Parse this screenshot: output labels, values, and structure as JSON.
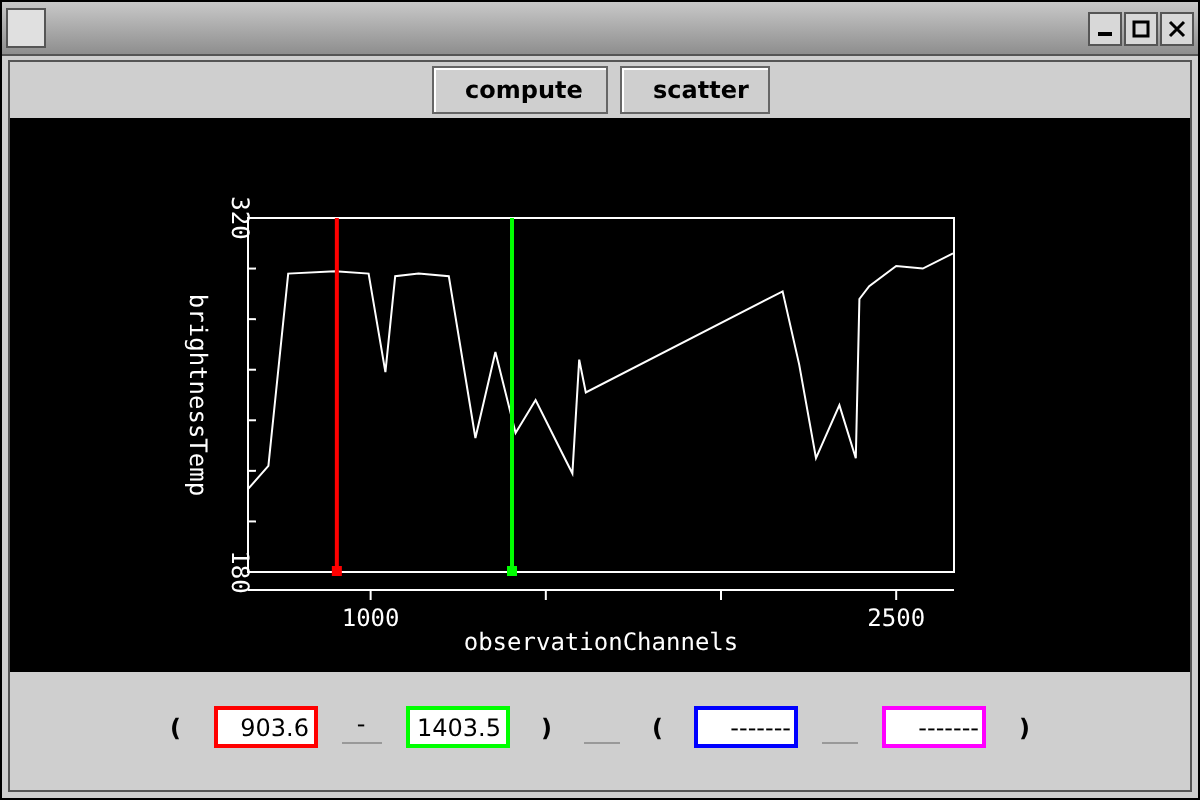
{
  "toolbar": {
    "buttons": [
      "compute",
      "scatter"
    ]
  },
  "plot": {
    "chart_data": {
      "type": "line",
      "xlabel": "observationChannels",
      "ylabel": "brightnessTemp",
      "xlim": [
        650,
        2665
      ],
      "ylim": [
        180,
        320
      ],
      "xticks": [
        1000,
        2500
      ],
      "yticks": [
        180,
        320
      ],
      "x": [
        651,
        708,
        765,
        899,
        994,
        1042,
        1070,
        1137,
        1223,
        1299,
        1356,
        1414,
        1471,
        1547,
        1576,
        1595,
        1614,
        2176,
        2223,
        2271,
        2338,
        2385,
        2395,
        2423,
        2500,
        2576,
        2662
      ],
      "series": [
        {
          "color": "#ffffff",
          "values": [
            213,
            222,
            298,
            299,
            298,
            259,
            297,
            298,
            297,
            233,
            267,
            235,
            248,
            227,
            219,
            264,
            251,
            291,
            262,
            225,
            246,
            225,
            288,
            293,
            301,
            300,
            306
          ]
        }
      ],
      "ref_lines": [
        {
          "axis": "x",
          "value": 903.6,
          "color": "#ff0000"
        },
        {
          "axis": "x",
          "value": 1403.5,
          "color": "#00ff00"
        }
      ]
    }
  },
  "bottom_bar": {
    "items": [
      {
        "kind": "paren",
        "text": "("
      },
      {
        "kind": "field",
        "value": "903.6",
        "color": "#ff0000"
      },
      {
        "kind": "line",
        "text": "-"
      },
      {
        "kind": "field",
        "value": "1403.5",
        "color": "#00ff00"
      },
      {
        "kind": "paren",
        "text": ")"
      },
      {
        "kind": "line"
      },
      {
        "kind": "paren",
        "text": "("
      },
      {
        "kind": "field",
        "value": "-------",
        "color": "#0000ff"
      },
      {
        "kind": "line"
      },
      {
        "kind": "field",
        "value": "-------",
        "color": "#ff00ff"
      },
      {
        "kind": "paren",
        "text": ")"
      }
    ]
  }
}
